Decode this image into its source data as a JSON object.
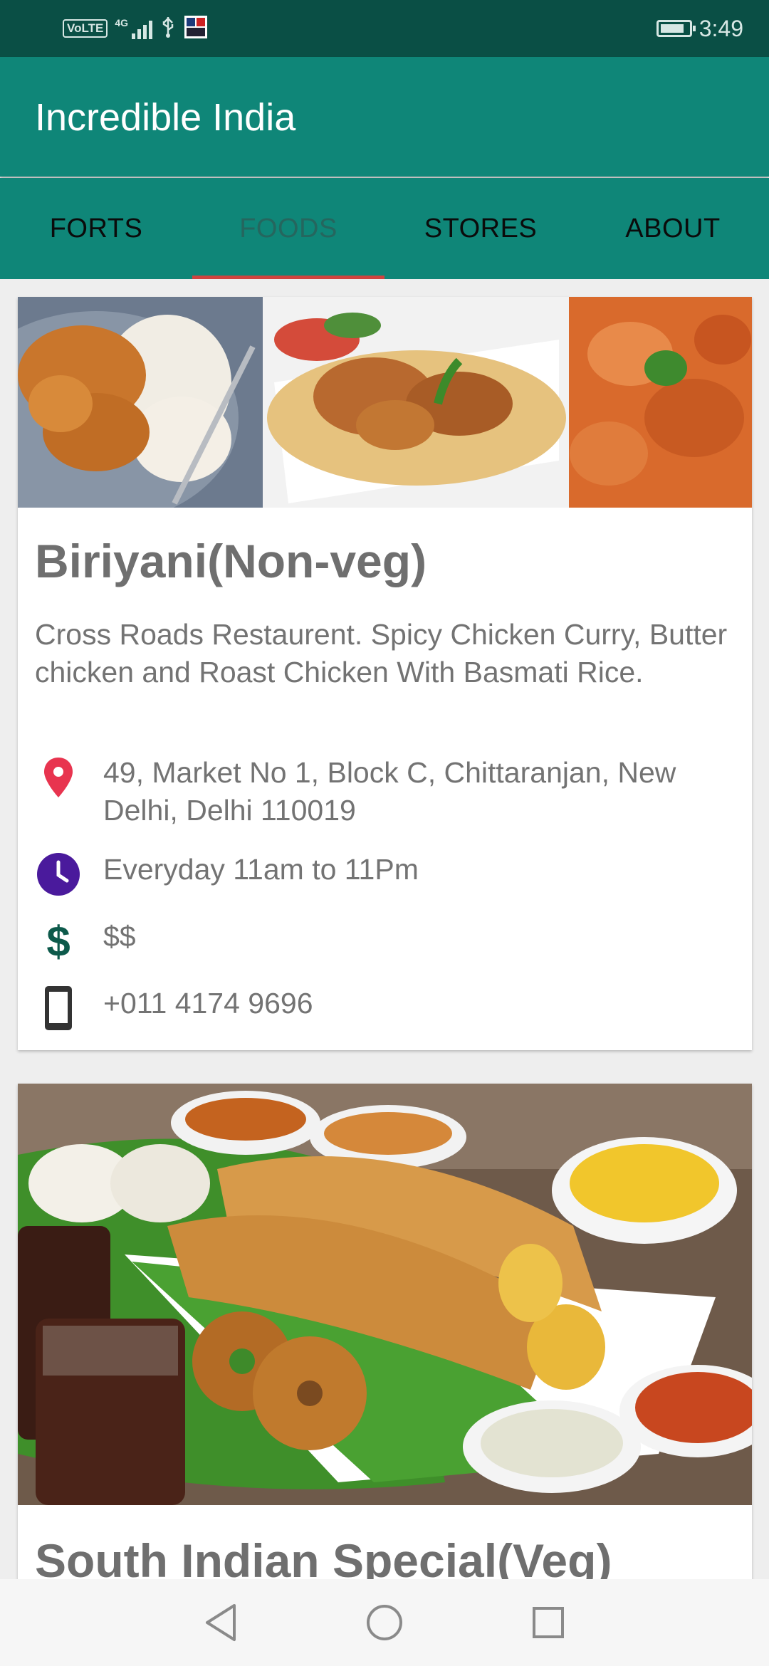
{
  "status_bar": {
    "volte": "VoLTE",
    "network": "4G",
    "time": "3:49",
    "battery_level": 0.85
  },
  "app": {
    "title": "Incredible India"
  },
  "tabs": [
    {
      "label": "FORTS",
      "active": false
    },
    {
      "label": "FOODS",
      "active": true
    },
    {
      "label": "STORES",
      "active": false
    },
    {
      "label": "ABOUT",
      "active": false
    }
  ],
  "cards": [
    {
      "title": "Biriyani(Non-veg)",
      "description": "Cross Roads Restaurent. Spicy Chicken Curry, Butter chicken and Roast Chicken With Basmati Rice.",
      "address": "49, Market No 1, Block C, Chittaranjan, New Delhi, Delhi 110019",
      "hours": "Everyday 11am to 11Pm",
      "price": "$$",
      "phone": "+011 4174 9696"
    },
    {
      "title": "South Indian Special(Veg)"
    }
  ],
  "icons": {
    "location": "location-pin-icon",
    "clock": "clock-icon",
    "price": "dollar-icon",
    "phone": "phone-icon"
  },
  "colors": {
    "status_bar": "#0a4f45",
    "app_bar": "#0f8678",
    "tab_indicator": "#d0433f",
    "pin": "#e8344f",
    "clock": "#4a1a9c",
    "dollar": "#0d5a4b"
  },
  "nav": {
    "back": "back-icon",
    "home": "home-icon",
    "recents": "recents-icon"
  }
}
